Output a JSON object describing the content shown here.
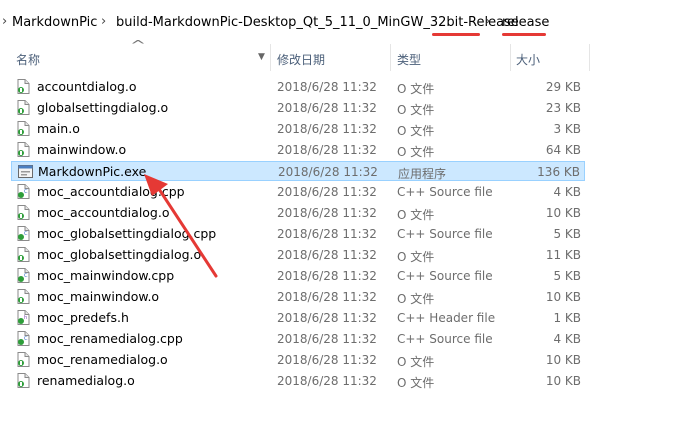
{
  "breadcrumb": {
    "items": [
      "MarkdownPic",
      "build-MarkdownPic-Desktop_Qt_5_11_0_MinGW_32bit-Release",
      "release"
    ],
    "separator": "›"
  },
  "columns": {
    "name": "名称",
    "date": "修改日期",
    "type": "类型",
    "size": "大小"
  },
  "files": [
    {
      "name": "accountdialog.o",
      "date": "2018/6/28 11:32",
      "type": "O 文件",
      "size": "29 KB",
      "icon": "object-file-icon"
    },
    {
      "name": "globalsettingdialog.o",
      "date": "2018/6/28 11:32",
      "type": "O 文件",
      "size": "23 KB",
      "icon": "object-file-icon"
    },
    {
      "name": "main.o",
      "date": "2018/6/28 11:32",
      "type": "O 文件",
      "size": "3 KB",
      "icon": "object-file-icon"
    },
    {
      "name": "mainwindow.o",
      "date": "2018/6/28 11:32",
      "type": "O 文件",
      "size": "64 KB",
      "icon": "object-file-icon"
    },
    {
      "name": "MarkdownPic.exe",
      "date": "2018/6/28 11:32",
      "type": "应用程序",
      "size": "136 KB",
      "icon": "executable-icon",
      "selected": true
    },
    {
      "name": "moc_accountdialog.cpp",
      "date": "2018/6/28 11:32",
      "type": "C++ Source file",
      "size": "4 KB",
      "icon": "cpp-file-icon"
    },
    {
      "name": "moc_accountdialog.o",
      "date": "2018/6/28 11:32",
      "type": "O 文件",
      "size": "10 KB",
      "icon": "object-file-icon"
    },
    {
      "name": "moc_globalsettingdialog.cpp",
      "date": "2018/6/28 11:32",
      "type": "C++ Source file",
      "size": "5 KB",
      "icon": "cpp-file-icon"
    },
    {
      "name": "moc_globalsettingdialog.o",
      "date": "2018/6/28 11:32",
      "type": "O 文件",
      "size": "11 KB",
      "icon": "object-file-icon"
    },
    {
      "name": "moc_mainwindow.cpp",
      "date": "2018/6/28 11:32",
      "type": "C++ Source file",
      "size": "5 KB",
      "icon": "cpp-file-icon"
    },
    {
      "name": "moc_mainwindow.o",
      "date": "2018/6/28 11:32",
      "type": "O 文件",
      "size": "10 KB",
      "icon": "object-file-icon"
    },
    {
      "name": "moc_predefs.h",
      "date": "2018/6/28 11:32",
      "type": "C++ Header file",
      "size": "1 KB",
      "icon": "header-file-icon"
    },
    {
      "name": "moc_renamedialog.cpp",
      "date": "2018/6/28 11:32",
      "type": "C++ Source file",
      "size": "4 KB",
      "icon": "cpp-file-icon"
    },
    {
      "name": "moc_renamedialog.o",
      "date": "2018/6/28 11:32",
      "type": "O 文件",
      "size": "10 KB",
      "icon": "object-file-icon"
    },
    {
      "name": "renamedialog.o",
      "date": "2018/6/28 11:32",
      "type": "O 文件",
      "size": "10 KB",
      "icon": "object-file-icon"
    }
  ],
  "colors": {
    "selection_bg": "#cce8ff",
    "selection_border": "#99d1ff",
    "annotation_red": "#e53935",
    "header_text": "#4c607a"
  }
}
